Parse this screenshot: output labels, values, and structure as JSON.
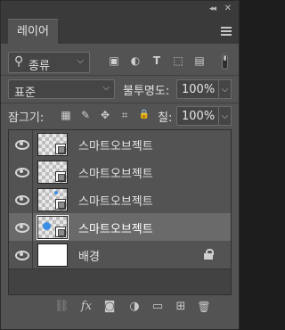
{
  "window": {
    "collapse_glyph": "◂◂",
    "close_glyph": "✕"
  },
  "tabs": [
    {
      "label": "레이어"
    }
  ],
  "filter": {
    "kind_label": "종류",
    "search_icon_glyph": "⚲",
    "chevron_glyph": "⌵",
    "icons": [
      "image-filter-icon",
      "adjustment-filter-icon",
      "text-filter-icon",
      "shape-filter-icon",
      "smart-object-filter-icon"
    ],
    "icon_glyphs": [
      "▣",
      "◐",
      "T",
      "⬚",
      "▤"
    ]
  },
  "blend": {
    "mode": "표준",
    "opacity_label": "불투명도:",
    "opacity_value": "100%"
  },
  "lock": {
    "label": "잠그기:",
    "icons": [
      "lock-transparent-icon",
      "lock-image-icon",
      "lock-position-icon",
      "lock-artboard-icon",
      "lock-all-icon"
    ],
    "icon_glyphs": [
      "▦",
      "✎",
      "✥",
      "⌗",
      "🔒"
    ],
    "fill_label": "칠:",
    "fill_value": "100%"
  },
  "layers": [
    {
      "name": "스마트오브젝트",
      "kind": "smart-object",
      "selected": false,
      "visible": true
    },
    {
      "name": "스마트오브젝트",
      "kind": "smart-object",
      "selected": false,
      "visible": true
    },
    {
      "name": "스마트오브젝트",
      "kind": "smart-object",
      "selected": false,
      "visible": true
    },
    {
      "name": "스마트오브젝트",
      "kind": "smart-object",
      "selected": true,
      "visible": true
    },
    {
      "name": "배경",
      "kind": "background",
      "selected": false,
      "visible": true,
      "locked": true
    }
  ],
  "bottom_bar": {
    "icons": [
      "link-layers-icon",
      "fx-icon",
      "add-mask-icon",
      "adjustment-layer-icon",
      "new-group-icon",
      "new-layer-icon",
      "delete-layer-icon"
    ],
    "glyphs": [
      "⛓",
      "fx",
      "◙",
      "◑",
      "▭",
      "⊞",
      "🗑"
    ]
  },
  "colors": {
    "panel": "#535353",
    "selected_row": "#6a6a6a",
    "accent_blue": "#3a8ee6"
  }
}
